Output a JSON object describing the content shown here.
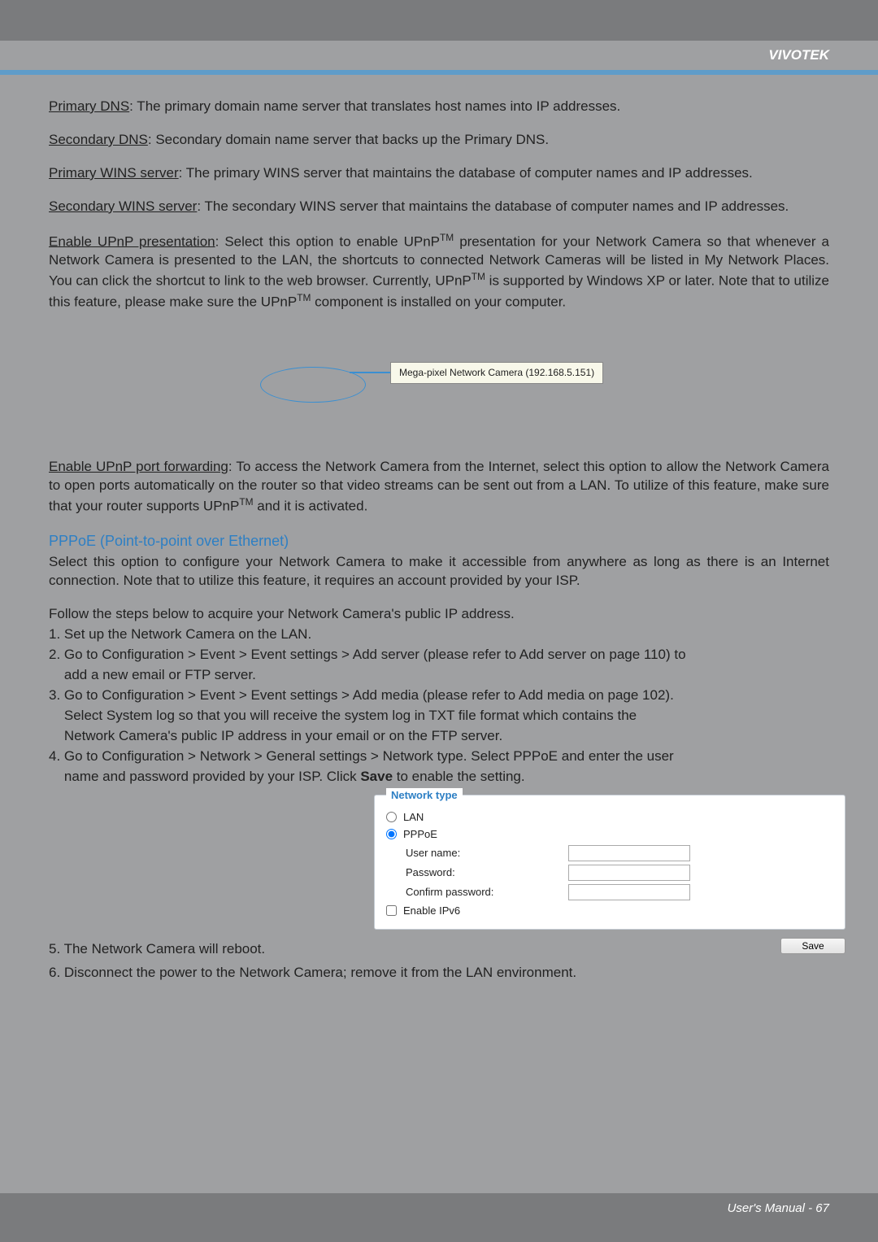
{
  "brand": "VIVOTEK",
  "definitions": {
    "primary_dns": {
      "term": "Primary DNS",
      "text": ": The primary domain name server that translates host names into IP addresses."
    },
    "secondary_dns": {
      "term": "Secondary DNS",
      "text": ": Secondary domain name server that backs up the Primary DNS."
    },
    "primary_wins": {
      "term": "Primary WINS server",
      "text": ": The primary WINS server that maintains the database of computer names and IP addresses."
    },
    "secondary_wins": {
      "term": "Secondary WINS server",
      "text": ": The secondary WINS server that maintains the database of computer names and IP addresses."
    },
    "upnp_presentation": {
      "term": "Enable UPnP presentation",
      "text_a": ": Select this option to enable UPnP",
      "tm1": "TM",
      "text_b": " presentation for your Network Camera so that whenever a Network Camera is presented to the LAN, the shortcuts to connected Network Cameras will be listed in My Network Places. You can click the shortcut to link to the web browser. Currently, UPnP",
      "tm2": "TM",
      "text_c": " is supported by Windows XP or later. Note that to utilize this feature, please make sure the UPnP",
      "tm3": "TM",
      "text_d": " component is installed on your computer."
    },
    "upnp_port": {
      "term": "Enable UPnP port forwarding",
      "text_a": ": To access the Network Camera from the Internet, select this option to allow the Network Camera to open ports automatically on the router so that video streams can be sent out from a LAN. To utilize of this feature, make sure that your router supports UPnP",
      "tm": "TM",
      "text_b": " and it is activated."
    }
  },
  "callout_label": "Mega-pixel Network Camera (192.168.5.151)",
  "pppoe": {
    "title": "PPPoE (Point-to-point over Ethernet)",
    "intro": "Select this option to configure your Network Camera to make it accessible from anywhere as long as there is an Internet connection. Note that to utilize this feature, it requires an account provided by your ISP.",
    "follow": "Follow the steps below to acquire your Network Camera's public IP address.",
    "step1": "1. Set up the Network Camera on the LAN.",
    "step2a": "2. Go to Configuration > Event > Event settings > Add server (please refer to Add server on page 110) to",
    "step2b": "    add a new email or FTP server.",
    "step3a": "3. Go to Configuration > Event > Event settings > Add media (please refer to Add media on page 102).",
    "step3b": "    Select System log so that you will receive the system log in TXT file format which contains the",
    "step3c": "    Network Camera's public IP address in your email or on the FTP server.",
    "step4a": "4. Go to Configuration > Network > General settings > Network type. Select PPPoE and enter the user",
    "step4b_pre": "    name and password provided by your ISP. Click ",
    "step4b_bold": "Save",
    "step4b_post": " to enable the setting.",
    "step5": "5. The Network Camera will reboot.",
    "step6": "6. Disconnect the power to the Network Camera; remove it from the LAN environment."
  },
  "panel": {
    "legend": "Network type",
    "lan": "LAN",
    "pppoe": "PPPoE",
    "username": "User name:",
    "password": "Password:",
    "confirm": "Confirm password:",
    "ipv6": "Enable IPv6",
    "save": "Save"
  },
  "footer": "User's Manual - 67"
}
